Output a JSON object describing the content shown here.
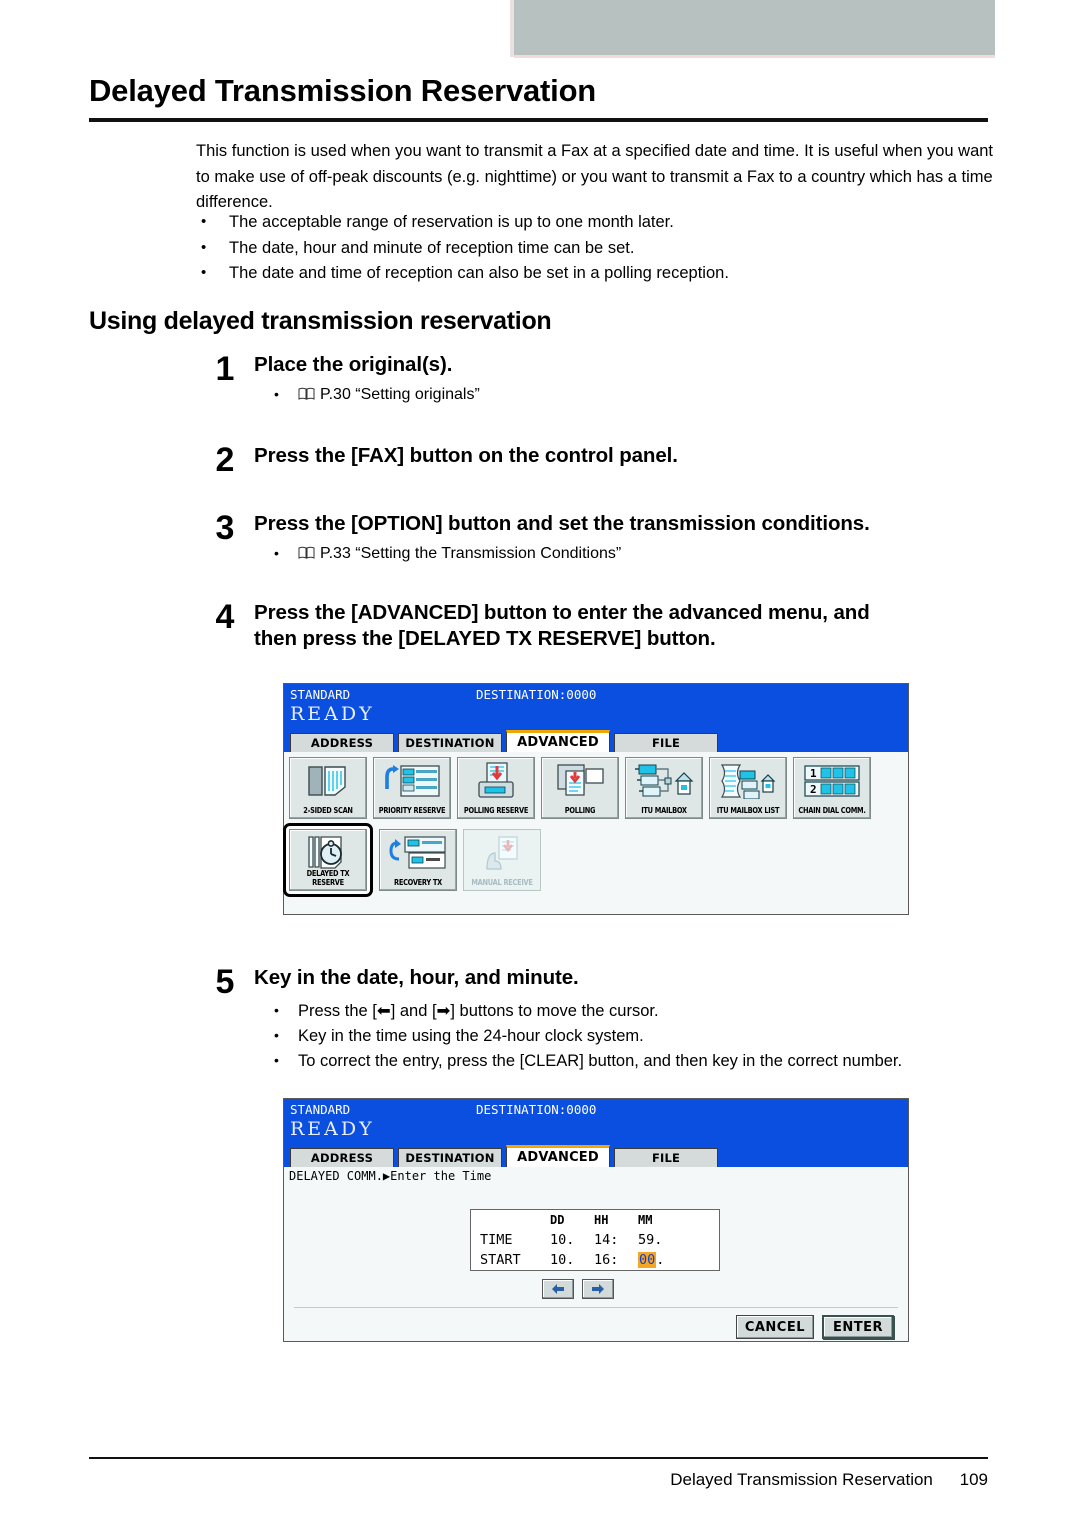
{
  "document": {
    "title": "Delayed Transmission Reservation",
    "intro": "This function is used when you want to transmit a Fax at a specified date and time. It is useful when you want to make use of off-peak discounts (e.g. nighttime) or you want to transmit a Fax to a country which has a time difference.",
    "intro_bullets": [
      "The acceptable range of reservation is up to one month later.",
      "The date, hour and minute of reception time can be set.",
      "The date and time of reception can also be set in a polling reception."
    ],
    "section_heading": "Using delayed transmission reservation",
    "footer_title": "Delayed Transmission Reservation",
    "footer_page": "109"
  },
  "steps": [
    {
      "number": "1",
      "title": "Place the original(s).",
      "reference": "P.30 “Setting originals”"
    },
    {
      "number": "2",
      "title": "Press the [FAX] button on the control panel."
    },
    {
      "number": "3",
      "title": "Press the [OPTION] button and set the transmission conditions.",
      "reference": "P.33 “Setting the Transmission Conditions”"
    },
    {
      "number": "4",
      "title_line1": "Press the [ADVANCED] button to enter the advanced menu, and",
      "title_line2": "then press the [DELAYED TX RESERVE] button."
    },
    {
      "number": "5",
      "title": "Key in the date, hour, and minute.",
      "bullets": [
        "Press the [⬅] and [➡] buttons to move the cursor.",
        "Key in the time using the 24-hour clock system.",
        "To correct the entry, press the [CLEAR] button, and then key in the correct number."
      ]
    }
  ],
  "lcd_advanced": {
    "status": "STANDARD",
    "destination": "DESTINATION:0000",
    "ready": "READY",
    "tabs": [
      {
        "label": "ADDRESS",
        "active": false
      },
      {
        "label": "DESTINATION",
        "active": false
      },
      {
        "label": "ADVANCED",
        "active": true
      },
      {
        "label": "FILE",
        "active": false
      }
    ],
    "icons_row1": [
      {
        "label": "2-SIDED SCAN",
        "name": "two-sided-scan",
        "state": "normal"
      },
      {
        "label": "PRIORITY RESERVE",
        "name": "priority-reserve",
        "state": "normal"
      },
      {
        "label": "POLLING RESERVE",
        "name": "polling-reserve",
        "state": "normal"
      },
      {
        "label": "POLLING",
        "name": "polling",
        "state": "normal"
      },
      {
        "label": "ITU MAILBOX",
        "name": "itu-mailbox",
        "state": "normal"
      },
      {
        "label": "ITU MAILBOX LIST",
        "name": "itu-mailbox-list",
        "state": "normal"
      },
      {
        "label": "CHAIN DIAL COMM.",
        "name": "chain-dial-comm",
        "state": "normal"
      }
    ],
    "icons_row2": [
      {
        "label": "DELAYED TX RESERVE",
        "name": "delayed-tx-reserve",
        "state": "selected"
      },
      {
        "label": "RECOVERY TX",
        "name": "recovery-tx",
        "state": "normal"
      },
      {
        "label": "MANUAL RECEIVE",
        "name": "manual-receive",
        "state": "disabled"
      }
    ]
  },
  "lcd_time_entry": {
    "status": "STANDARD",
    "destination": "DESTINATION:0000",
    "ready": "READY",
    "tabs": [
      {
        "label": "ADDRESS",
        "active": false
      },
      {
        "label": "DESTINATION",
        "active": false
      },
      {
        "label": "ADVANCED",
        "active": true
      },
      {
        "label": "FILE",
        "active": false
      }
    ],
    "breadcrumb_root": "DELAYED COMM.",
    "breadcrumb_arrow": "▶",
    "breadcrumb_leaf": "Enter the Time",
    "table": {
      "headers": [
        "DD",
        "HH",
        "MM"
      ],
      "rows": [
        {
          "label": "TIME",
          "dd": "10.",
          "hh": "14:",
          "mm": "59.",
          "mm_highlight": false
        },
        {
          "label": "START",
          "dd": "10.",
          "hh": "16:",
          "mm": "00",
          "mm_suffix": ".",
          "mm_highlight": true
        }
      ]
    },
    "nav": {
      "left": "⬅",
      "right": "➡"
    },
    "buttons": {
      "cancel": "CANCEL",
      "enter": "ENTER"
    }
  },
  "colors": {
    "lcd_blue": "#0b4fe0",
    "tab_active_accent": "#f0a800",
    "highlight_bg": "#f5a623",
    "highlight_fg": "#1040d0",
    "banner_gray": "#b6c1c0"
  }
}
